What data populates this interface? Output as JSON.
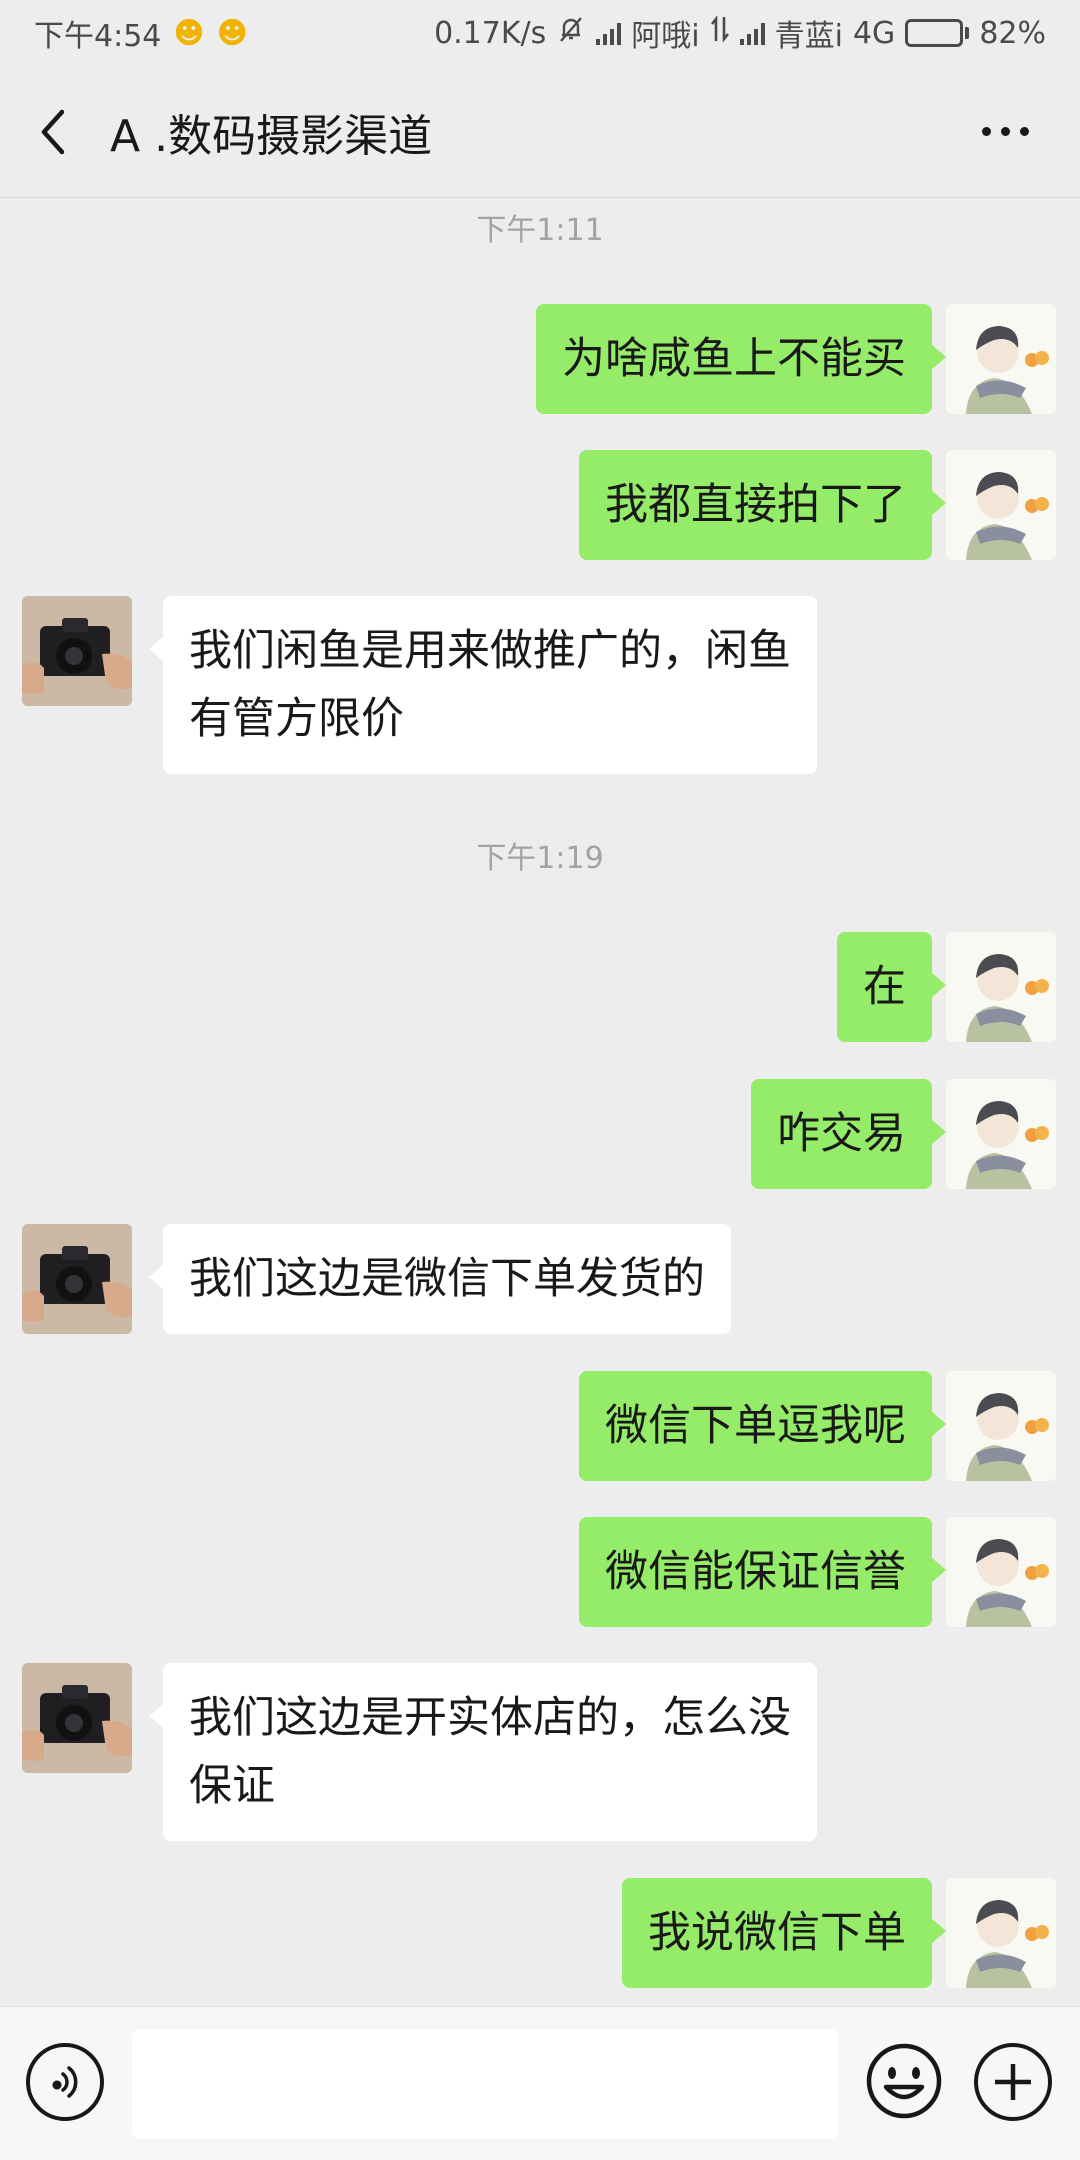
{
  "status_bar": {
    "time": "下午4:54",
    "speed": "0.17K/s",
    "carrier1": "阿哦i",
    "carrier2": "青蓝i",
    "network": "4G",
    "battery": "82%",
    "battery_level": 0.82
  },
  "nav": {
    "title": "A .数码摄影渠道",
    "back_icon": "chevron-left-icon",
    "more_icon": "more-dots-icon"
  },
  "chat": {
    "timestamps": [
      "下午1:11",
      "下午1:19"
    ],
    "messages": [
      {
        "sender": "self",
        "text": "为啥咸鱼上不能买"
      },
      {
        "sender": "self",
        "text": "我都直接拍下了"
      },
      {
        "sender": "other",
        "lines": [
          "我们闲鱼是用来做推广的，闲鱼",
          "有管方限价"
        ]
      },
      {
        "sender": "self",
        "text": "在"
      },
      {
        "sender": "self",
        "text": "咋交易"
      },
      {
        "sender": "other",
        "text": "我们这边是微信下单发货的"
      },
      {
        "sender": "self",
        "text": "微信下单逗我呢"
      },
      {
        "sender": "self",
        "text": "微信能保证信誉"
      },
      {
        "sender": "other",
        "lines": [
          "我们这边是开实体店的，怎么没",
          "保证"
        ]
      },
      {
        "sender": "self",
        "text": "我说微信下单"
      }
    ]
  },
  "input_bar": {
    "voice_icon": "voice-icon",
    "input_value": "",
    "emoji_icon": "emoji-icon",
    "add_icon": "plus-circle-icon"
  },
  "colors": {
    "background": "#ededed",
    "self_bubble": "#95ec69",
    "other_bubble": "#ffffff"
  }
}
